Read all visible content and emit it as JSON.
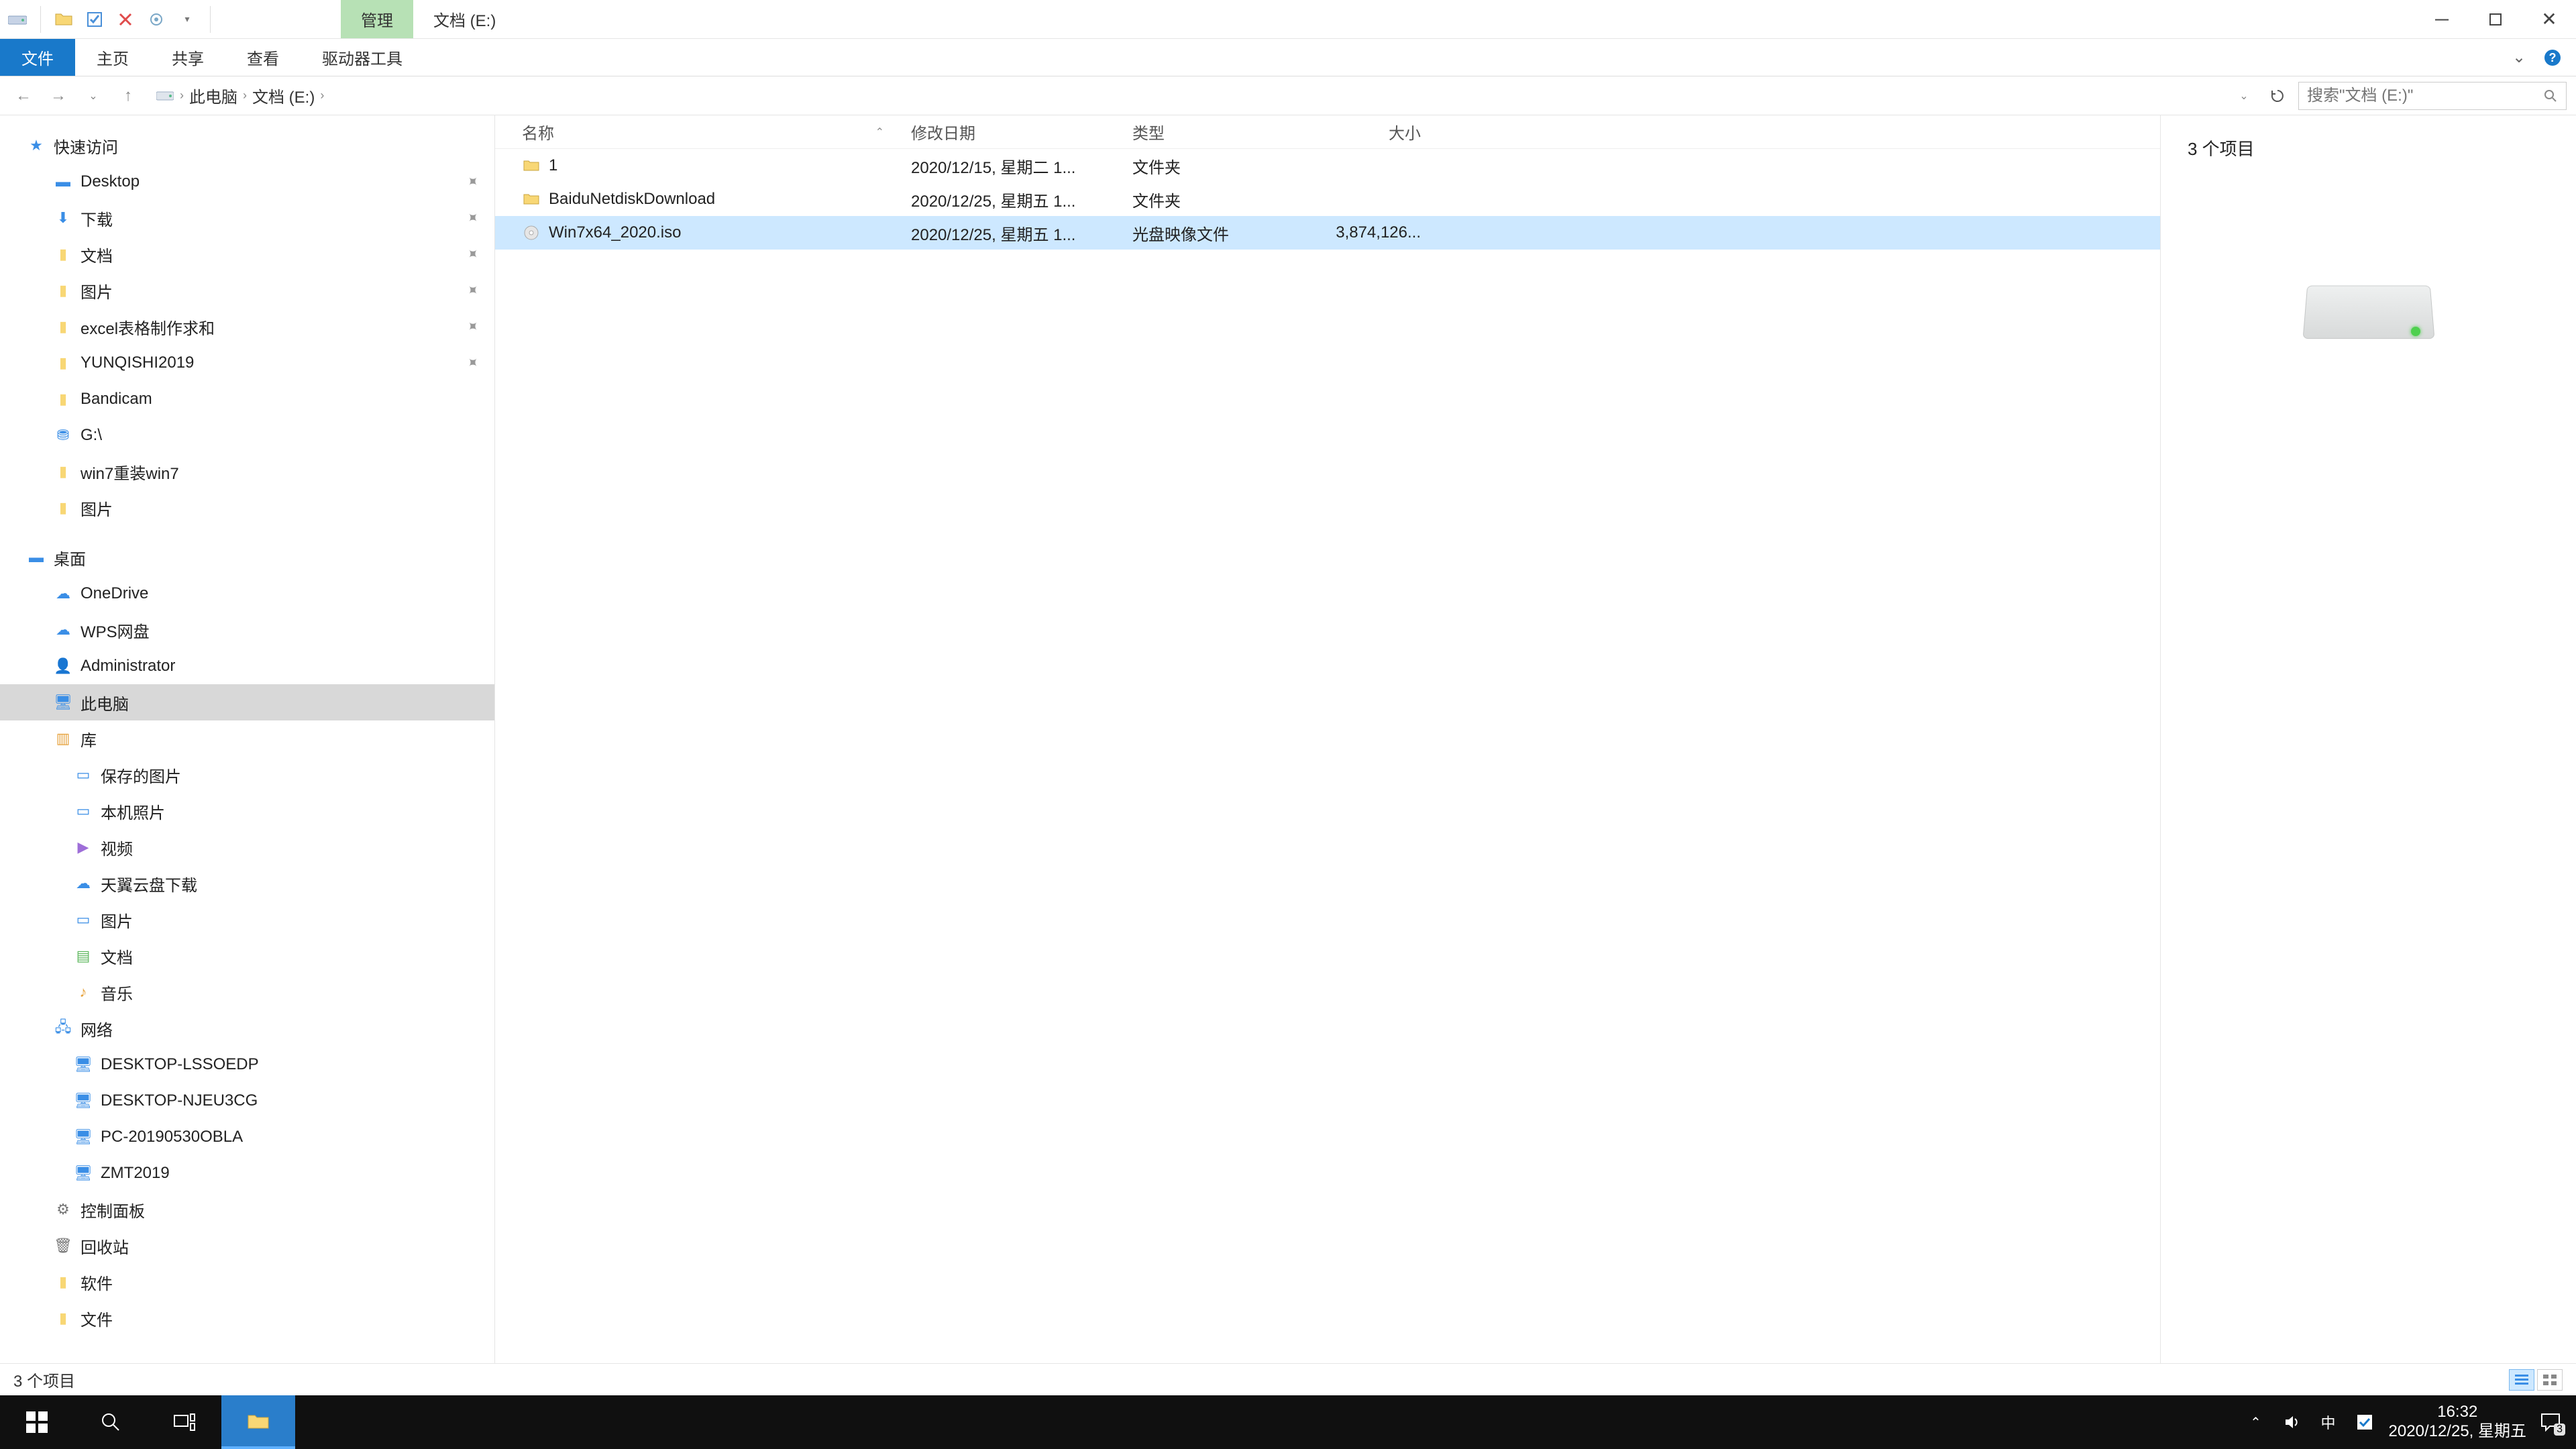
{
  "window": {
    "context_tab": "管理",
    "title_path": "文档 (E:)"
  },
  "ribbon": {
    "tabs": {
      "file": "文件",
      "home": "主页",
      "share": "共享",
      "view": "查看",
      "drive_tools": "驱动器工具"
    }
  },
  "nav": {
    "back_glyph": "←",
    "forward_glyph": "→",
    "up_glyph": "↑"
  },
  "breadcrumb": {
    "root": "此电脑",
    "drive": "文档 (E:)",
    "sep": "›"
  },
  "search": {
    "placeholder": "搜索\"文档 (E:)\""
  },
  "tree": {
    "quick_access": "快速访问",
    "desktop": "Desktop",
    "downloads": "下载",
    "documents": "文档",
    "pictures": "图片",
    "excel": "excel表格制作求和",
    "yunqishi": "YUNQISHI2019",
    "bandicam": "Bandicam",
    "gdrive": "G:\\",
    "win7reinstall": "win7重装win7",
    "pictures2": "图片",
    "desk_section": "桌面",
    "onedrive": "OneDrive",
    "wps": "WPS网盘",
    "admin": "Administrator",
    "this_pc": "此电脑",
    "libraries": "库",
    "saved_pics": "保存的图片",
    "camera_roll": "本机照片",
    "videos": "视频",
    "tianyi": "天翼云盘下载",
    "lib_pictures": "图片",
    "lib_docs": "文档",
    "lib_music": "音乐",
    "network": "网络",
    "net1": "DESKTOP-LSSOEDP",
    "net2": "DESKTOP-NJEU3CG",
    "net3": "PC-20190530OBLA",
    "net4": "ZMT2019",
    "control_panel": "控制面板",
    "recycle": "回收站",
    "software": "软件",
    "files": "文件"
  },
  "columns": {
    "name": "名称",
    "date": "修改日期",
    "type": "类型",
    "size": "大小"
  },
  "rows": [
    {
      "name": "1",
      "date": "2020/12/15, 星期二 1...",
      "type": "文件夹",
      "size": "",
      "icon": "folder"
    },
    {
      "name": "BaiduNetdiskDownload",
      "date": "2020/12/25, 星期五 1...",
      "type": "文件夹",
      "size": "",
      "icon": "folder"
    },
    {
      "name": "Win7x64_2020.iso",
      "date": "2020/12/25, 星期五 1...",
      "type": "光盘映像文件",
      "size": "3,874,126...",
      "icon": "disc",
      "selected": true
    }
  ],
  "preview": {
    "count_text": "3 个项目"
  },
  "status": {
    "text": "3 个项目"
  },
  "tray": {
    "time": "16:32",
    "date": "2020/12/25, 星期五",
    "ime": "中",
    "action_badge": "3"
  }
}
